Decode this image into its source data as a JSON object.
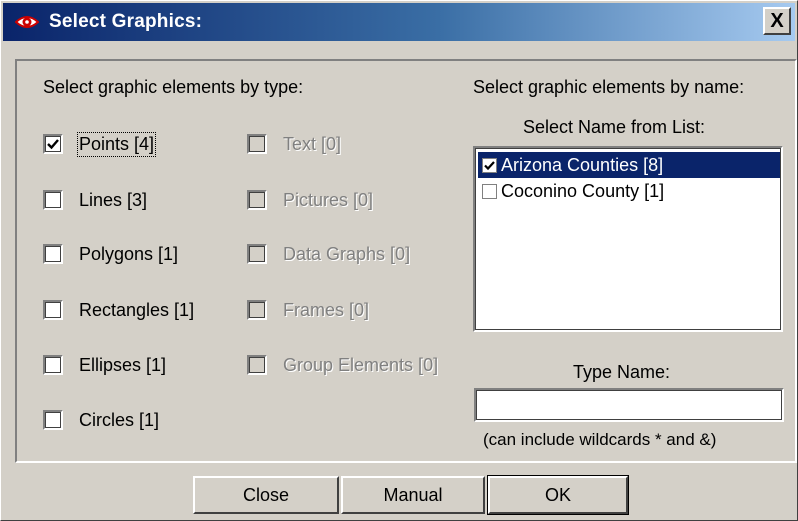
{
  "dialog": {
    "title": "Select Graphics:",
    "close_glyph": "X",
    "app_icon": "eye-icon"
  },
  "by_type": {
    "heading": "Select graphic elements by type:",
    "left_column": [
      {
        "label": "Points [4]",
        "checked": true,
        "enabled": true
      },
      {
        "label": "Lines [3]",
        "checked": false,
        "enabled": true
      },
      {
        "label": "Polygons [1]",
        "checked": false,
        "enabled": true
      },
      {
        "label": "Rectangles [1]",
        "checked": false,
        "enabled": true
      },
      {
        "label": "Ellipses [1]",
        "checked": false,
        "enabled": true
      },
      {
        "label": "Circles [1]",
        "checked": false,
        "enabled": true
      }
    ],
    "right_column": [
      {
        "label": "Text [0]",
        "checked": false,
        "enabled": false
      },
      {
        "label": "Pictures [0]",
        "checked": false,
        "enabled": false
      },
      {
        "label": "Data Graphs [0]",
        "checked": false,
        "enabled": false
      },
      {
        "label": "Frames [0]",
        "checked": false,
        "enabled": false
      },
      {
        "label": "Group Elements [0]",
        "checked": false,
        "enabled": false
      }
    ]
  },
  "by_name": {
    "heading": "Select graphic elements by name:",
    "list_label": "Select Name from List:",
    "list_items": [
      {
        "label": "Arizona Counties [8]",
        "checked": true,
        "selected": true
      },
      {
        "label": "Coconino County [1]",
        "checked": false,
        "selected": false
      }
    ],
    "type_name_label": "Type Name:",
    "type_name_value": "",
    "wildcard_hint": "(can include wildcards * and &)"
  },
  "buttons": {
    "close": "Close",
    "manual": "Manual",
    "ok": "OK"
  },
  "colors": {
    "title_bar": "#0a246a",
    "selection": "#0a246a",
    "face": "#d4d0c8"
  }
}
